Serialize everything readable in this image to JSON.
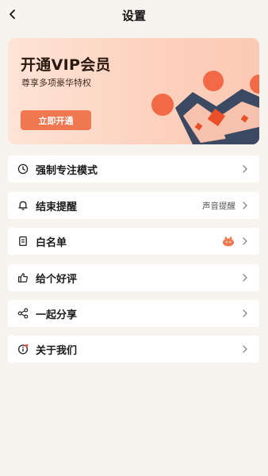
{
  "header": {
    "title": "设置",
    "back_icon": "chevron-left-icon"
  },
  "vip": {
    "title": "开通VIP会员",
    "subtitle": "尊享多项豪华特权",
    "button_label": "立即开通",
    "accent_color": "#f07850"
  },
  "settings": {
    "items": [
      {
        "label": "强制专注模式",
        "icon": "clock-icon",
        "value": ""
      },
      {
        "label": "结束提醒",
        "icon": "bell-icon",
        "value": "声音提醒"
      },
      {
        "label": "白名单",
        "icon": "document-icon",
        "value": "",
        "badge_icon": "mascot-icon"
      },
      {
        "label": "给个好评",
        "icon": "thumbs-up-icon",
        "value": ""
      },
      {
        "label": "一起分享",
        "icon": "share-icon",
        "value": ""
      },
      {
        "label": "关于我们",
        "icon": "info-icon",
        "value": "",
        "has_dot": true
      }
    ]
  }
}
